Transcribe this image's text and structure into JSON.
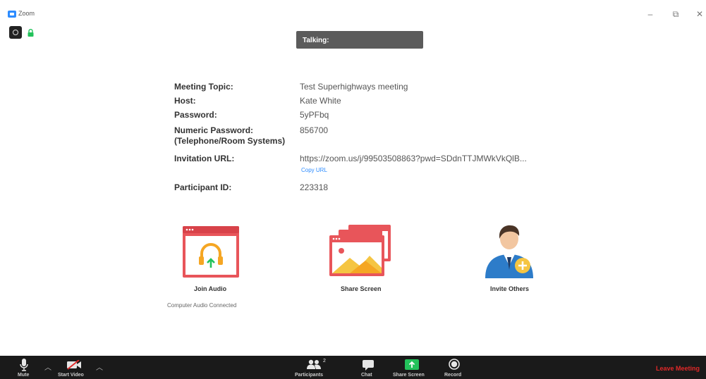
{
  "window": {
    "title": "Zoom",
    "minimize": "–",
    "maximize": "⧉",
    "close": "✕"
  },
  "talking": {
    "label": "Talking:"
  },
  "meeting_info": {
    "rows": [
      {
        "label": "Meeting Topic:",
        "value": "Test Superhighways meeting"
      },
      {
        "label": "Host:",
        "value": "Kate White"
      },
      {
        "label": "Password:",
        "value": "5yPFbq"
      },
      {
        "label": "Numeric Password:\n(Telephone/Room Systems)",
        "value": "856700"
      },
      {
        "label": "Invitation URL:",
        "value": "https://zoom.us/j/99503508863?pwd=SDdnTTJMWkVkQlB..."
      },
      {
        "label": "Participant ID:",
        "value": "223318"
      }
    ],
    "numeric_password_label_line1": "Numeric Password:",
    "numeric_password_label_line2": "(Telephone/Room Systems)",
    "copy_url_label": "Copy URL"
  },
  "actions": {
    "join_audio": "Join Audio",
    "audio_status": "Computer Audio Connected",
    "share_screen": "Share Screen",
    "invite_others": "Invite Others"
  },
  "toolbar": {
    "mute": "Mute",
    "start_video": "Start Video",
    "participants": "Participants",
    "participants_count": "2",
    "chat": "Chat",
    "share_screen": "Share Screen",
    "record": "Record",
    "leave": "Leave Meeting"
  },
  "icons": {
    "app": "zoom-app-icon",
    "recording": "recording-icon",
    "encryption": "lock-icon",
    "microphone": "microphone-icon",
    "video_off": "video-off-icon",
    "participants": "participants-icon",
    "chat": "chat-icon",
    "share": "share-screen-icon",
    "record": "record-icon",
    "headphones": "headphones-icon",
    "invite": "invite-person-icon"
  },
  "colors": {
    "accent_blue": "#2d8cff",
    "tile_red": "#e8555a",
    "share_green": "#23c25b",
    "leave_red": "#e02828",
    "toolbar_bg": "#1a1a1a"
  }
}
